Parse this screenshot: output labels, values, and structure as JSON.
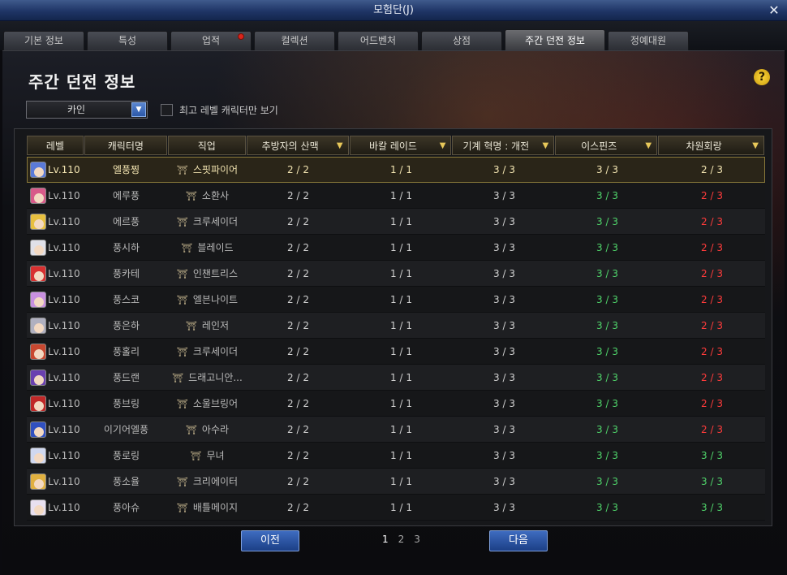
{
  "window": {
    "title": "모험단(J)"
  },
  "tabs": [
    {
      "label": "기본 정보",
      "active": false
    },
    {
      "label": "특성",
      "active": false
    },
    {
      "label": "업적",
      "active": false,
      "badge": true
    },
    {
      "label": "컬렉션",
      "active": false
    },
    {
      "label": "어드벤처",
      "active": false
    },
    {
      "label": "상점",
      "active": false
    },
    {
      "label": "주간 던전 정보",
      "active": true
    },
    {
      "label": "정예대원",
      "active": false
    }
  ],
  "page": {
    "title": "주간 던전 정보",
    "server_selected": "카인",
    "filter_label": "최고 레벨 캐릭터만 보기"
  },
  "table": {
    "headers": [
      "레벨",
      "캐릭터명",
      "직업",
      "추방자의 산맥",
      "바칼 레이드",
      "기계 혁명 : 개전",
      "이스핀즈",
      "차원회랑"
    ],
    "rows": [
      {
        "level": "Lv.110",
        "name": "엘풍찡",
        "job": "스핏파이어",
        "d1": "2 / 2",
        "d2": "1 / 1",
        "d3": "3 / 3",
        "d4": "3 / 3",
        "d5": "2 / 3",
        "d5_status": "red",
        "avatar_color": "#5a7ad8"
      },
      {
        "level": "Lv.110",
        "name": "에루풍",
        "job": "소환사",
        "d1": "2 / 2",
        "d2": "1 / 1",
        "d3": "3 / 3",
        "d4": "3 / 3",
        "d5": "2 / 3",
        "d5_status": "red",
        "avatar_color": "#d85a8a"
      },
      {
        "level": "Lv.110",
        "name": "에르풍",
        "job": "크루세이더",
        "d1": "2 / 2",
        "d2": "1 / 1",
        "d3": "3 / 3",
        "d4": "3 / 3",
        "d5": "2 / 3",
        "d5_status": "red",
        "avatar_color": "#e8c040"
      },
      {
        "level": "Lv.110",
        "name": "풍시하",
        "job": "블레이드",
        "d1": "2 / 2",
        "d2": "1 / 1",
        "d3": "3 / 3",
        "d4": "3 / 3",
        "d5": "2 / 3",
        "d5_status": "red",
        "avatar_color": "#e0e0e8"
      },
      {
        "level": "Lv.110",
        "name": "풍카테",
        "job": "인챈트리스",
        "d1": "2 / 2",
        "d2": "1 / 1",
        "d3": "3 / 3",
        "d4": "3 / 3",
        "d5": "2 / 3",
        "d5_status": "red",
        "avatar_color": "#d83030"
      },
      {
        "level": "Lv.110",
        "name": "풍스코",
        "job": "엘븐나이트",
        "d1": "2 / 2",
        "d2": "1 / 1",
        "d3": "3 / 3",
        "d4": "3 / 3",
        "d5": "2 / 3",
        "d5_status": "red",
        "avatar_color": "#c890e0"
      },
      {
        "level": "Lv.110",
        "name": "풍은하",
        "job": "레인저",
        "d1": "2 / 2",
        "d2": "1 / 1",
        "d3": "3 / 3",
        "d4": "3 / 3",
        "d5": "2 / 3",
        "d5_status": "red",
        "avatar_color": "#b0b0c0"
      },
      {
        "level": "Lv.110",
        "name": "풍홀리",
        "job": "크루세이더",
        "d1": "2 / 2",
        "d2": "1 / 1",
        "d3": "3 / 3",
        "d4": "3 / 3",
        "d5": "2 / 3",
        "d5_status": "red",
        "avatar_color": "#c84830"
      },
      {
        "level": "Lv.110",
        "name": "풍드랜",
        "job": "드래고니안...",
        "d1": "2 / 2",
        "d2": "1 / 1",
        "d3": "3 / 3",
        "d4": "3 / 3",
        "d5": "2 / 3",
        "d5_status": "red",
        "avatar_color": "#6a40b0"
      },
      {
        "level": "Lv.110",
        "name": "풍브링",
        "job": "소울브링어",
        "d1": "2 / 2",
        "d2": "1 / 1",
        "d3": "3 / 3",
        "d4": "3 / 3",
        "d5": "2 / 3",
        "d5_status": "red",
        "avatar_color": "#c02828"
      },
      {
        "level": "Lv.110",
        "name": "이기어엘풍",
        "job": "아수라",
        "d1": "2 / 2",
        "d2": "1 / 1",
        "d3": "3 / 3",
        "d4": "3 / 3",
        "d5": "2 / 3",
        "d5_status": "red",
        "avatar_color": "#3050c0"
      },
      {
        "level": "Lv.110",
        "name": "풍로링",
        "job": "무녀",
        "d1": "2 / 2",
        "d2": "1 / 1",
        "d3": "3 / 3",
        "d4": "3 / 3",
        "d5": "3 / 3",
        "d5_status": "green",
        "avatar_color": "#d0d8f0"
      },
      {
        "level": "Lv.110",
        "name": "풍소율",
        "job": "크리에이터",
        "d1": "2 / 2",
        "d2": "1 / 1",
        "d3": "3 / 3",
        "d4": "3 / 3",
        "d5": "3 / 3",
        "d5_status": "green",
        "avatar_color": "#e0b040"
      },
      {
        "level": "Lv.110",
        "name": "풍아슈",
        "job": "배틀메이지",
        "d1": "2 / 2",
        "d2": "1 / 1",
        "d3": "3 / 3",
        "d4": "3 / 3",
        "d5": "3 / 3",
        "d5_status": "green",
        "avatar_color": "#e8e0f0"
      }
    ],
    "selected_row": 0
  },
  "pager": {
    "prev_label": "이전",
    "next_label": "다음",
    "pages": [
      "1",
      "2",
      "3"
    ],
    "current_page": "1"
  },
  "colors": {
    "complete_green": "#4fd36a",
    "incomplete_red": "#ff3b3b",
    "accent_blue": "#2c58a8",
    "header_gold": "#e8c85a"
  },
  "icons": {
    "close": "close-icon",
    "help": "help-icon",
    "sort": "sort-down-icon",
    "class": "class-emblem-icon"
  }
}
